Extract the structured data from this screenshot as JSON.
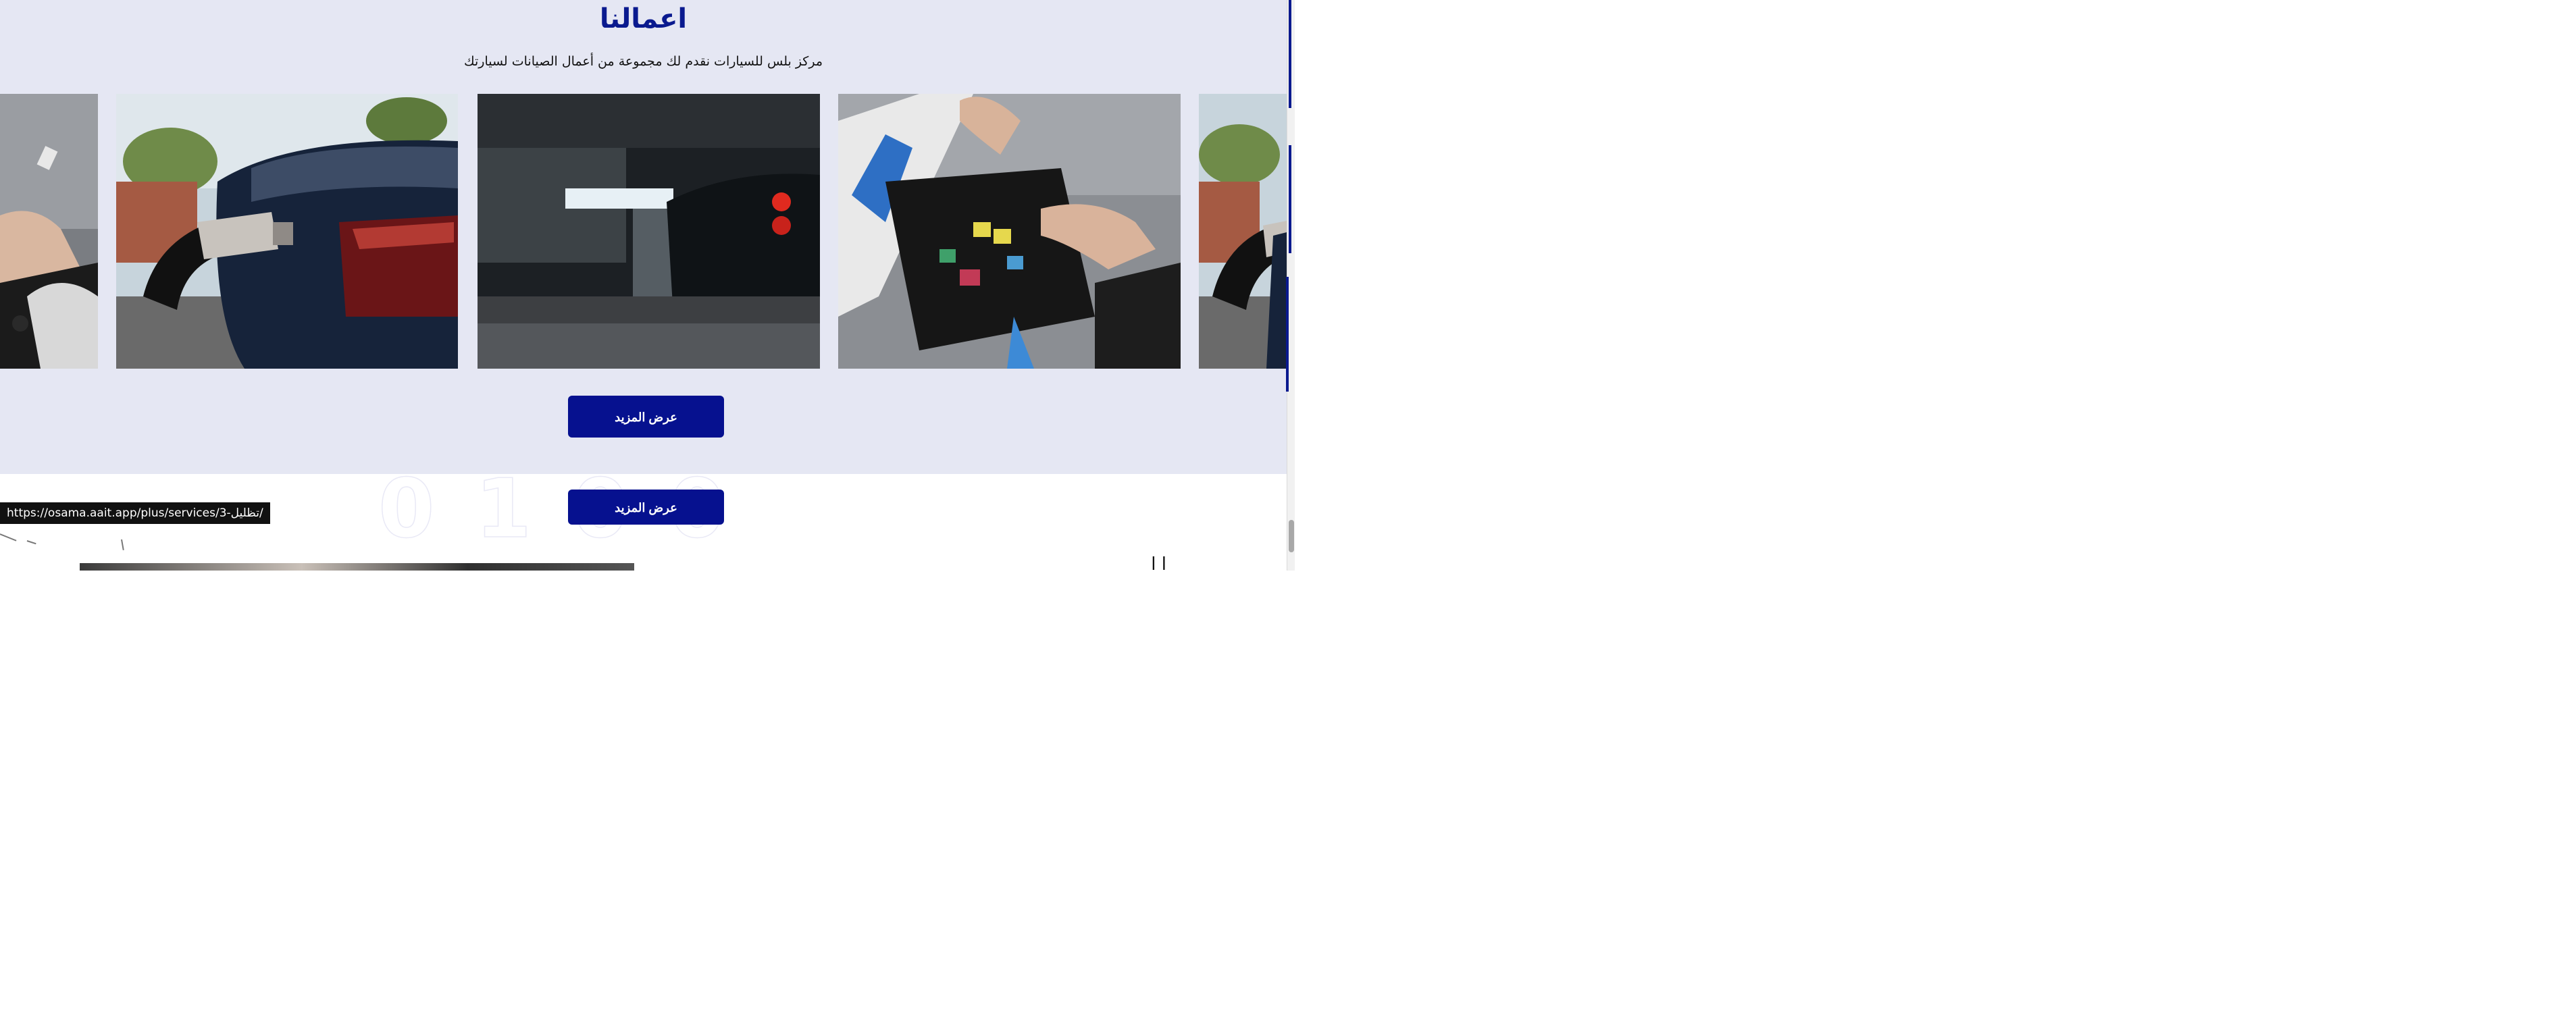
{
  "works": {
    "title": "اعمالنا",
    "subtitle": "مركز بلس للسيارات نقدم لك مجموعة من أعمال الصيانات لسيارتك",
    "slides": [
      {
        "name": "engine-wiring-partial-left",
        "alt": "hands checking car wiring"
      },
      {
        "name": "ev-charging",
        "alt": "electric car charging"
      },
      {
        "name": "garage-car",
        "alt": "car inside garage"
      },
      {
        "name": "engine-wiring",
        "alt": "mechanic checking fuse box"
      },
      {
        "name": "ev-charging-partial-right",
        "alt": "electric car charging"
      }
    ],
    "more_button": "عرض المزيد"
  },
  "services": {
    "more_button": "عرض المزيد"
  },
  "status_url": "https://osama.aait.app/plus/services/3-تظليل/",
  "colors": {
    "brand": "#06118f",
    "section_bg": "#e5e7f3"
  }
}
